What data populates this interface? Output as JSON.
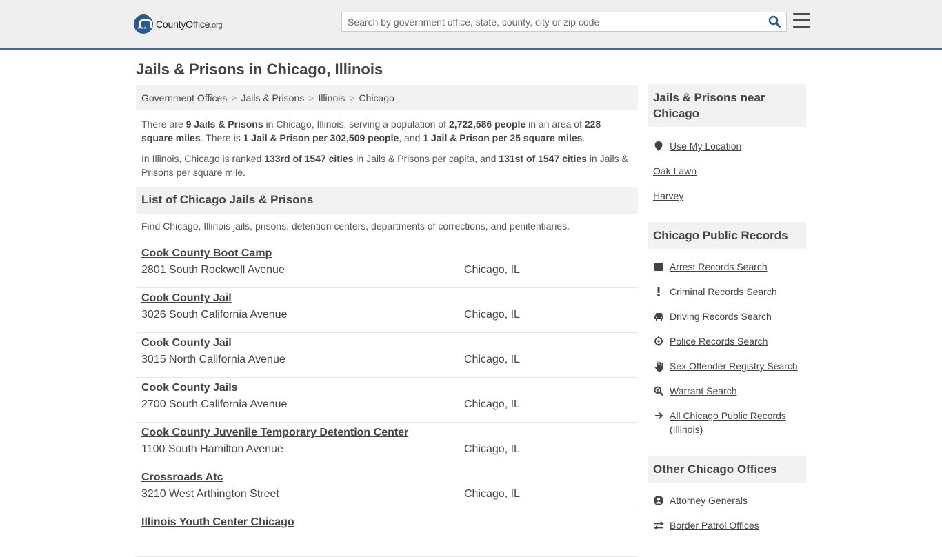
{
  "header": {
    "logo_text": "CountyOffice",
    "logo_suffix": ".org",
    "search_placeholder": "Search by government office, state, county, city or zip code"
  },
  "page_title": "Jails & Prisons in Chicago, Illinois",
  "breadcrumb": [
    "Government Offices",
    "Jails & Prisons",
    "Illinois",
    "Chicago"
  ],
  "intro": {
    "p1": [
      {
        "t": "There are "
      },
      {
        "t": "9 Jails & Prisons",
        "b": true
      },
      {
        "t": " in Chicago, Illinois, serving a population of "
      },
      {
        "t": "2,722,586 people",
        "b": true
      },
      {
        "t": " in an area of "
      },
      {
        "t": "228 square miles",
        "b": true
      },
      {
        "t": ". There is "
      },
      {
        "t": "1 Jail & Prison per 302,509 people",
        "b": true
      },
      {
        "t": ", and "
      },
      {
        "t": "1 Jail & Prison per 25 square miles",
        "b": true
      },
      {
        "t": "."
      }
    ],
    "p2": [
      {
        "t": "In Illinois, Chicago is ranked "
      },
      {
        "t": "133rd of 1547 cities",
        "b": true
      },
      {
        "t": " in Jails & Prisons per capita, and "
      },
      {
        "t": "131st of 1547 cities",
        "b": true
      },
      {
        "t": " in Jails & Prisons per square mile."
      }
    ]
  },
  "list": {
    "heading": "List of Chicago Jails & Prisons",
    "description": "Find Chicago, Illinois jails, prisons, detention centers, departments of corrections, and penitentiaries.",
    "items": [
      {
        "name": "Cook County Boot Camp",
        "address": "2801 South Rockwell Avenue",
        "city": "Chicago, IL"
      },
      {
        "name": "Cook County Jail",
        "address": "3026 South California Avenue",
        "city": "Chicago, IL"
      },
      {
        "name": "Cook County Jail",
        "address": "3015 North California Avenue",
        "city": "Chicago, IL"
      },
      {
        "name": "Cook County Jails",
        "address": "2700 South California Avenue",
        "city": "Chicago, IL"
      },
      {
        "name": "Cook County Juvenile Temporary Detention Center",
        "address": "1100 South Hamilton Avenue",
        "city": "Chicago, IL"
      },
      {
        "name": "Crossroads Atc",
        "address": "3210 West Arthington Street",
        "city": "Chicago, IL"
      },
      {
        "name": "Illinois Youth Center Chicago",
        "address": "",
        "city": ""
      }
    ]
  },
  "sidebar": {
    "near": {
      "heading": "Jails & Prisons near Chicago",
      "use_location": "Use My Location",
      "cities": [
        "Oak Lawn",
        "Harvey"
      ]
    },
    "records": {
      "heading": "Chicago Public Records",
      "items": [
        {
          "label": "Arrest Records Search",
          "icon": "square-icon"
        },
        {
          "label": "Criminal Records Search",
          "icon": "exclamation-icon"
        },
        {
          "label": "Driving Records Search",
          "icon": "car-icon"
        },
        {
          "label": "Police Records Search",
          "icon": "crosshair-icon"
        },
        {
          "label": "Sex Offender Registry Search",
          "icon": "hand-icon"
        },
        {
          "label": "Warrant Search",
          "icon": "magnify-icon"
        },
        {
          "label": "All Chicago Public Records (Illinois)",
          "icon": "arrow-right-icon"
        }
      ]
    },
    "other": {
      "heading": "Other Chicago Offices",
      "items": [
        {
          "label": "Attorney Generals",
          "icon": "user-icon"
        },
        {
          "label": "Border Patrol Offices",
          "icon": "swap-icon"
        }
      ]
    }
  },
  "colors": {
    "header_bg": "#efefef",
    "header_border": "#3b6ea5",
    "brand_blue": "#2a5a94",
    "panel_bg": "#f2f2f2"
  }
}
